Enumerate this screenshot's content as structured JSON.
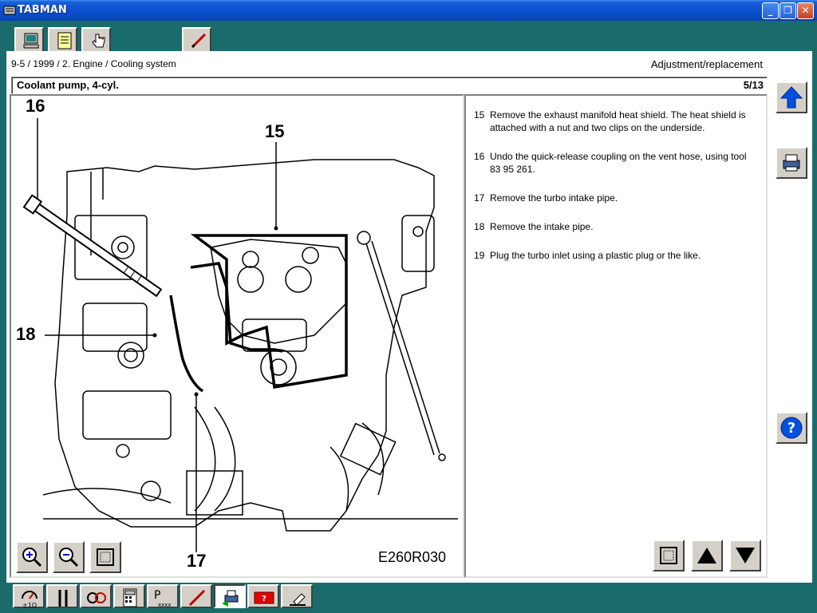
{
  "window": {
    "title": "TABMAN"
  },
  "top_toolbar": {
    "tools": [
      {
        "name": "computer",
        "icon": "computer-icon"
      },
      {
        "name": "document",
        "icon": "document-icon"
      },
      {
        "name": "hand-pointer",
        "icon": "hand-pointer-icon"
      },
      {
        "name": "pencil-active",
        "icon": "pencil-icon"
      }
    ]
  },
  "breadcrumb": "9-5 / 1999 / 2. Engine / Cooling system",
  "section": "Adjustment/replacement",
  "topic": {
    "title": "Coolant pump, 4-cyl.",
    "page": "5/13"
  },
  "diagram": {
    "code": "E260R030",
    "callouts": [
      "15",
      "16",
      "17",
      "18"
    ]
  },
  "steps": [
    {
      "num": "15",
      "text": "Remove the exhaust manifold heat shield. The heat shield is attached with a nut and two clips on the underside."
    },
    {
      "num": "16",
      "text": "Undo the quick-release coupling on the vent hose, using tool 83 95 261."
    },
    {
      "num": "17",
      "text": "Remove the turbo intake pipe."
    },
    {
      "num": "18",
      "text": "Remove the intake pipe."
    },
    {
      "num": "19",
      "text": "Plug the turbo inlet using a plastic plug or the like."
    }
  ],
  "image_controls": [
    "zoom-in",
    "zoom-out",
    "fit"
  ],
  "nav_controls": [
    "fit",
    "previous",
    "next"
  ],
  "side_buttons": [
    "up",
    "print",
    "help"
  ],
  "bottom_toolbar": [
    "gauge",
    "wrench",
    "diagnostics",
    "calculator",
    "part-numbers",
    "pencil",
    "print-topic",
    "warning",
    "stamp"
  ]
}
